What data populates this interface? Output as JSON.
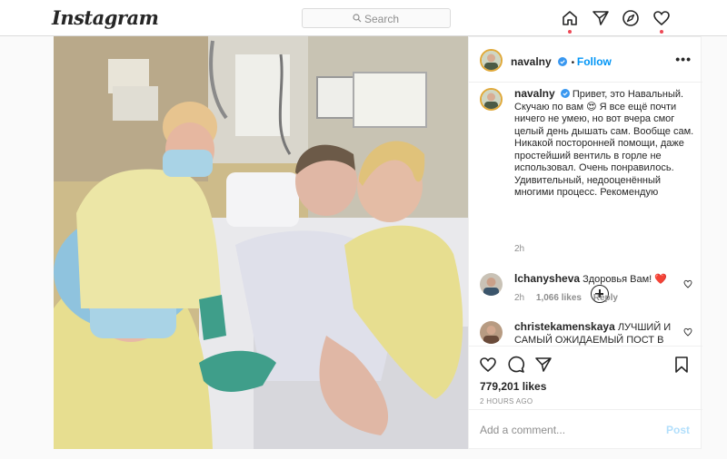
{
  "nav": {
    "logo": "Instagram",
    "search_placeholder": "Search",
    "icons": [
      "home-icon",
      "direct-icon",
      "explore-icon",
      "activity-heart-icon"
    ]
  },
  "post": {
    "image_alt": "Hospital selfie photo",
    "author": "navalny",
    "follow_label": "Follow",
    "more_label": "•••",
    "caption": "Привет, это Навальный. Скучаю по вам 😍 Я все ещё почти ничего не умею, но вот вчера смог целый день дышать сам. Вообще сам. Никакой посторонней помощи, даже простейший вентиль в горле не использовал. Очень понравилось. Удивительный, недооценённый многими процесс. Рекомендую",
    "caption_age": "2h"
  },
  "comments": [
    {
      "user": "lchanysheva",
      "text": "Здоровья Вам! ❤️",
      "age": "2h",
      "likes": "1,066 likes",
      "reply": "Reply"
    },
    {
      "user": "christekamenskaya",
      "text": "ЛУЧШИЙ И САМЫЙ ОЖИДАЕМЫЙ ПОСТ В"
    }
  ],
  "actions": {
    "likes": "779,201 likes",
    "timestamp": "2 HOURS AGO",
    "icons": [
      "like-icon",
      "comment-icon",
      "share-icon",
      "save-icon"
    ]
  },
  "add_comment": {
    "placeholder": "Add a comment...",
    "post_label": "Post"
  },
  "colors": {
    "accent": "#0095f6",
    "notification": "#ed4956",
    "border": "#dbdbdb"
  }
}
